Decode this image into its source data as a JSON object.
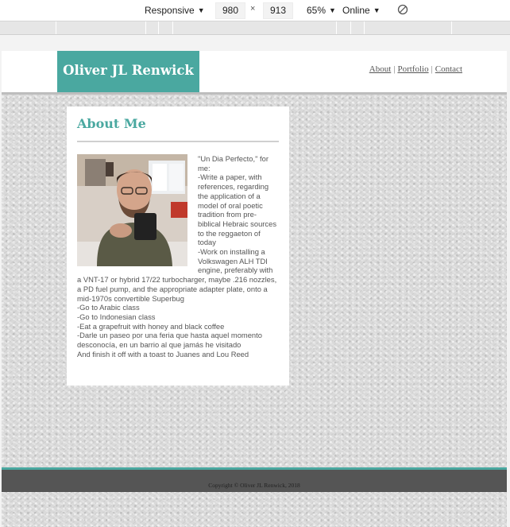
{
  "devtools": {
    "device_label": "Responsive",
    "width": "980",
    "times": "×",
    "height": "913",
    "zoom_label": "65%",
    "network_label": "Online"
  },
  "site": {
    "logo_text": "Oliver JL Renwick",
    "nav": [
      {
        "label": "About"
      },
      {
        "label": "Portfolio"
      },
      {
        "label": "Contact"
      }
    ],
    "nav_separator": "|",
    "about": {
      "heading": "About Me",
      "photo_alt": "Photo of a man with glasses holding a mug",
      "intro": "\"Un Dia Perfecto,\" for me:",
      "lines": [
        "-Write a paper, with references, regarding the application of a model of oral poetic tradition from pre-biblical Hebraic sources to the reggaeton of today",
        "-Work on installing a Volkswagen ALH TDI engine, preferably with a VNT-17 or hybrid 17/22 turbocharger, maybe .216 nozzles, a PD fuel pump, and the appropriate adapter plate, onto a mid-1970s convertible Superbug",
        "-Go to Arabic class",
        "-Go to Indonesian class",
        "-Eat a grapefruit with honey and black coffee",
        "-Darle un paseo por una feria que hasta aquel momento desconocía, en un barrio al que jamás he visitado",
        "And finish it off with a toast to Juanes and Lou Reed"
      ]
    },
    "footer": "Copyright © Oliver JL Renwick, 2018"
  },
  "colors": {
    "accent": "#4aa8a0",
    "footer_bg": "#555555"
  }
}
